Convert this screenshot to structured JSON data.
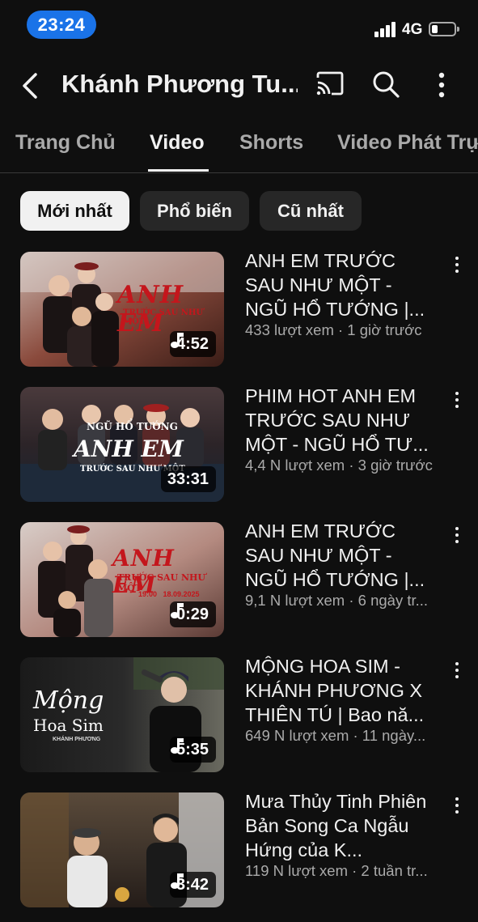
{
  "status_bar": {
    "time": "23:24",
    "network": "4G",
    "battery_level": 0.2
  },
  "header": {
    "title": "Khánh Phương Tu...",
    "icons": [
      "back-icon",
      "cast-icon",
      "search-icon",
      "more-vert-icon"
    ]
  },
  "tabs": [
    {
      "label": "Trang Chủ",
      "active": false
    },
    {
      "label": "Video",
      "active": true
    },
    {
      "label": "Shorts",
      "active": false
    },
    {
      "label": "Video Phát Trự",
      "active": false
    }
  ],
  "chips": [
    {
      "label": "Mới nhất",
      "active": true
    },
    {
      "label": "Phổ biến",
      "active": false
    },
    {
      "label": "Cũ nhất",
      "active": false
    }
  ],
  "videos": [
    {
      "title": "ANH EM TRƯỚC SAU NHƯ MỘT - NGŨ HỔ TƯỚNG |...",
      "meta": "433 lượt xem · 1 giờ trước",
      "duration": "4:52",
      "thumb_text": {
        "main": "ANH EM",
        "sub": "TRƯỚC SAU NHƯ MỘT"
      }
    },
    {
      "title": "PHIM HOT ANH EM TRƯỚC SAU NHƯ MỘT - NGŨ HỔ TƯ...",
      "meta": "4,4 N lượt xem · 3 giờ trước",
      "duration": "33:31",
      "thumb_text": {
        "top": "NGŨ HỔ TƯỚNG",
        "main": "ANH EM",
        "sub": "TRƯỚC SAU NHƯ MỘT"
      }
    },
    {
      "title": "ANH EM TRƯỚC SAU NHƯ MỘT - NGŨ HỔ TƯỚNG |...",
      "meta": "9,1 N lượt xem · 6 ngày tr...",
      "duration": "0:29",
      "thumb_text": {
        "main": "ANH EM",
        "sub": "TRƯỚC SAU NHƯ MỘT",
        "date": "19:00   18.09.2025"
      }
    },
    {
      "title": "MỘNG HOA SIM - KHÁNH PHƯƠNG X THIÊN TÚ | Bao nă...",
      "meta": "649 N lượt xem · 11 ngày...",
      "duration": "5:35",
      "thumb_text": {
        "main": "Mộng",
        "sub": "Hoa Sim",
        "credit": "KHÁNH PHƯƠNG"
      }
    },
    {
      "title": "Mưa Thủy Tinh Phiên Bản Song Ca Ngẫu Hứng của K...",
      "meta": "119 N lượt xem · 2 tuần tr...",
      "duration": "3:42",
      "thumb_text": {}
    }
  ]
}
